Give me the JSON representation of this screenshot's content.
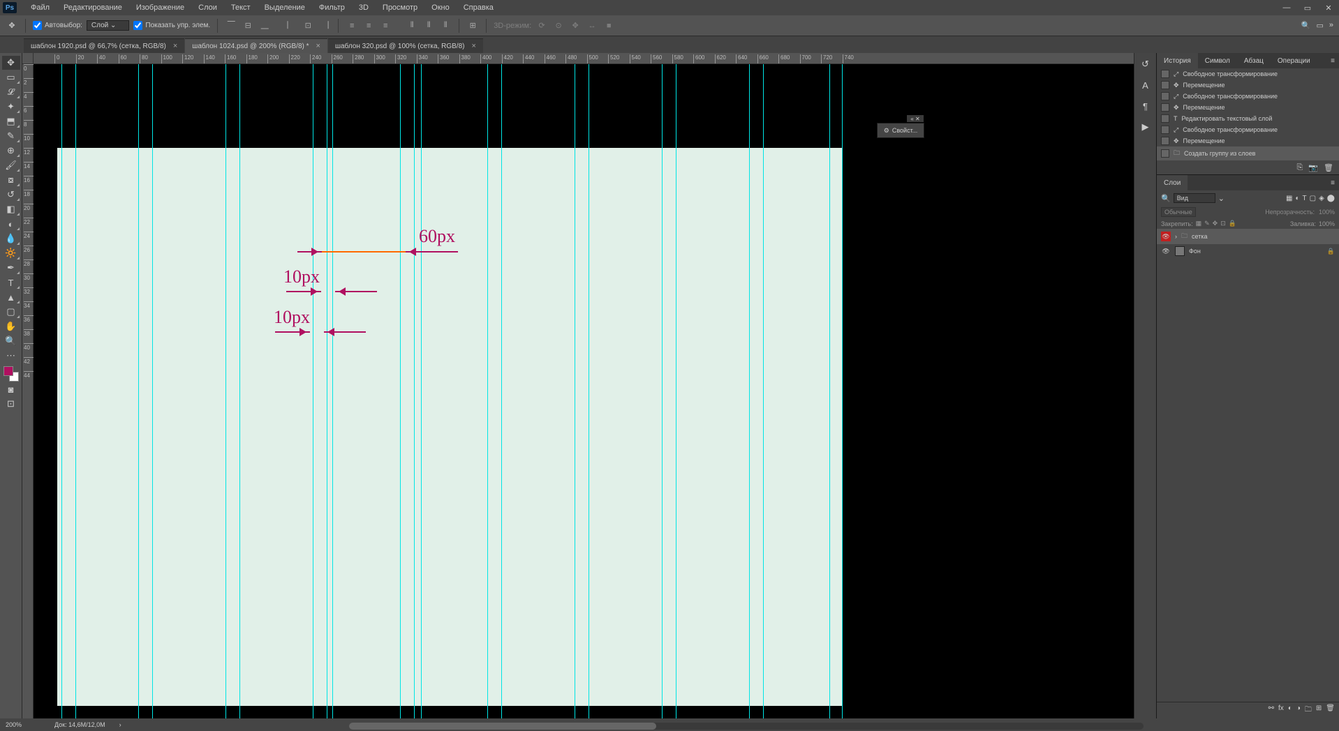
{
  "menu": [
    "Файл",
    "Редактирование",
    "Изображение",
    "Слои",
    "Текст",
    "Выделение",
    "Фильтр",
    "3D",
    "Просмотр",
    "Окно",
    "Справка"
  ],
  "options": {
    "autoselect": "Автовыбор:",
    "target": "Слой",
    "show_controls": "Показать упр. элем.",
    "mode3d": "3D-режим:"
  },
  "tabs": [
    {
      "label": "шаблон 1920.psd @ 66,7% (сетка, RGB/8)",
      "active": false
    },
    {
      "label": "шаблон 1024.psd @ 200% (RGB/8) *",
      "active": true
    },
    {
      "label": "шаблон 320.psd @ 100% (сетка, RGB/8)",
      "active": false
    }
  ],
  "ruler_h": [
    0,
    20,
    40,
    60,
    80,
    100,
    120,
    140,
    160,
    180,
    200,
    220,
    240,
    260,
    280,
    300,
    320,
    340,
    360,
    380,
    400,
    420,
    440,
    460,
    480,
    500,
    520,
    540,
    560,
    580,
    600,
    620,
    640,
    660,
    680,
    700,
    720,
    740
  ],
  "ruler_v": [
    0,
    2,
    4,
    6,
    8,
    10,
    12,
    14,
    16,
    18,
    20,
    22,
    24,
    26,
    28,
    30,
    32,
    34,
    36,
    38,
    40,
    42,
    44
  ],
  "annotations": {
    "a60": "60px",
    "a10a": "10px",
    "a10b": "10px"
  },
  "props_label": "Свойст...",
  "panel_tabs": {
    "history": [
      "История",
      "Символ",
      "Абзац",
      "Операции"
    ],
    "layers": "Слои"
  },
  "history": [
    "Свободное трансформирование",
    "Перемещение",
    "Свободное трансформирование",
    "Перемещение",
    "Редактировать текстовый слой",
    "Свободное трансформирование",
    "Перемещение",
    "Создать группу из слоев"
  ],
  "layers_filter": {
    "label": "Вид"
  },
  "blend": {
    "mode": "Обычные",
    "opacity_label": "Непрозрачность:",
    "opacity": "100%",
    "fill_label": "Заливка:",
    "fill": "100%",
    "lock": "Закрепить:"
  },
  "layers": [
    {
      "name": "сетка",
      "type": "group",
      "visible": true,
      "selected": true
    },
    {
      "name": "Фон",
      "type": "layer",
      "visible": true,
      "locked": true
    }
  ],
  "status": {
    "zoom": "200%",
    "doc": "Док: 14,6M/12,0M"
  }
}
